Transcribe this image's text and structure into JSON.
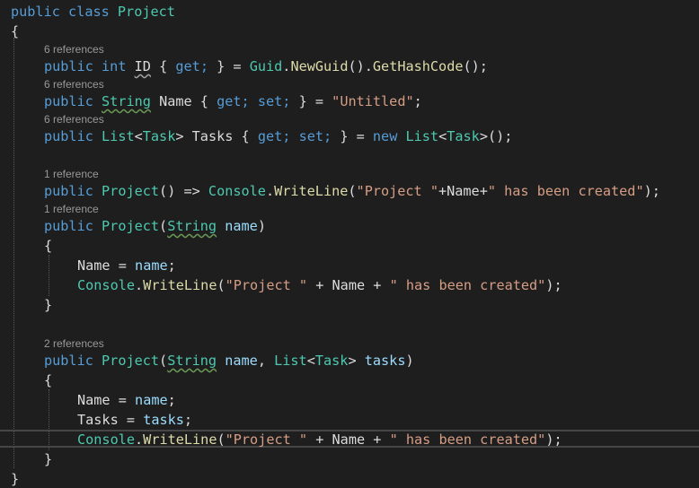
{
  "editor": {
    "colors": {
      "background": "#1e1e1e",
      "keyword": "#569cd6",
      "type": "#4ec9b0",
      "string": "#d69d85",
      "identifier": "#dcdcdc",
      "method": "#dcdcaa",
      "parameter": "#9cdcfe",
      "codelens": "#999999"
    },
    "code": {
      "class_decl": {
        "kw_public": "public",
        "kw_class": "class",
        "name": "Project"
      },
      "open_brace": "{",
      "lens_id": "6 references",
      "line_id": {
        "kw_public": "public",
        "kw_int": "int",
        "name": "ID",
        "open": "{",
        "get": "get;",
        "close": "} =",
        "type_guid": "Guid",
        "dot": ".",
        "m_newguid": "NewGuid",
        "paren1": "().",
        "m_hash": "GetHashCode",
        "paren2": "();"
      },
      "lens_name": "6 references",
      "line_name": {
        "kw_public": "public",
        "type": "String",
        "name": "Name",
        "open": "{",
        "get": "get;",
        "set": "set;",
        "close": "} =",
        "value": "\"Untitled\"",
        "end": ";"
      },
      "lens_tasks": "6 references",
      "line_tasks": {
        "kw_public": "public",
        "type_list": "List",
        "lt": "<",
        "type_task": "Task",
        "gt": ">",
        "name": "Tasks",
        "open": "{",
        "get": "get;",
        "set": "set;",
        "close": "} =",
        "kw_new": "new",
        "type_list2": "List",
        "lt2": "<",
        "type_task2": "Task",
        "gt2": ">",
        "end": "();"
      },
      "lens_ctor1": "1 reference",
      "line_ctor1": {
        "kw_public": "public",
        "name": "Project",
        "parens": "() =>",
        "type_console": "Console",
        "dot": ".",
        "method": "WriteLine",
        "open": "(",
        "s1": "\"Project \"",
        "plus1": "+Name+",
        "s2": "\" has been created\"",
        "end": ");"
      },
      "lens_ctor2": "1 reference",
      "line_ctor2": {
        "kw_public": "public",
        "name": "Project",
        "open": "(",
        "type": "String",
        "param": "name",
        "close": ")"
      },
      "ctor2_open": "{",
      "ctor2_assign": {
        "target": "Name",
        "eq": "=",
        "value": "name",
        "end": ";"
      },
      "ctor2_write": {
        "type_console": "Console",
        "dot": ".",
        "method": "WriteLine",
        "open": "(",
        "s1": "\"Project \"",
        "plus1": "+",
        "name": "Name",
        "plus2": "+",
        "s2": "\" has been created\"",
        "end": ");"
      },
      "ctor2_close": "}",
      "lens_ctor3": "2 references",
      "line_ctor3": {
        "kw_public": "public",
        "name": "Project",
        "open": "(",
        "type": "String",
        "param1": "name",
        "comma": ",",
        "type_list": "List",
        "lt": "<",
        "type_task": "Task",
        "gt": ">",
        "param2": "tasks",
        "close": ")"
      },
      "ctor3_open": "{",
      "ctor3_assign1": {
        "target": "Name",
        "eq": "=",
        "value": "name",
        "end": ";"
      },
      "ctor3_assign2": {
        "target": "Tasks",
        "eq": "=",
        "value": "tasks",
        "end": ";"
      },
      "ctor3_write": {
        "type_console": "Console",
        "dot": ".",
        "method": "WriteLine",
        "open": "(",
        "s1": "\"Project \"",
        "plus1": "+",
        "name": "Name",
        "plus2": "+",
        "s2": "\" has been created\"",
        "end": ");"
      },
      "ctor3_close": "}",
      "close_brace": "}"
    }
  }
}
